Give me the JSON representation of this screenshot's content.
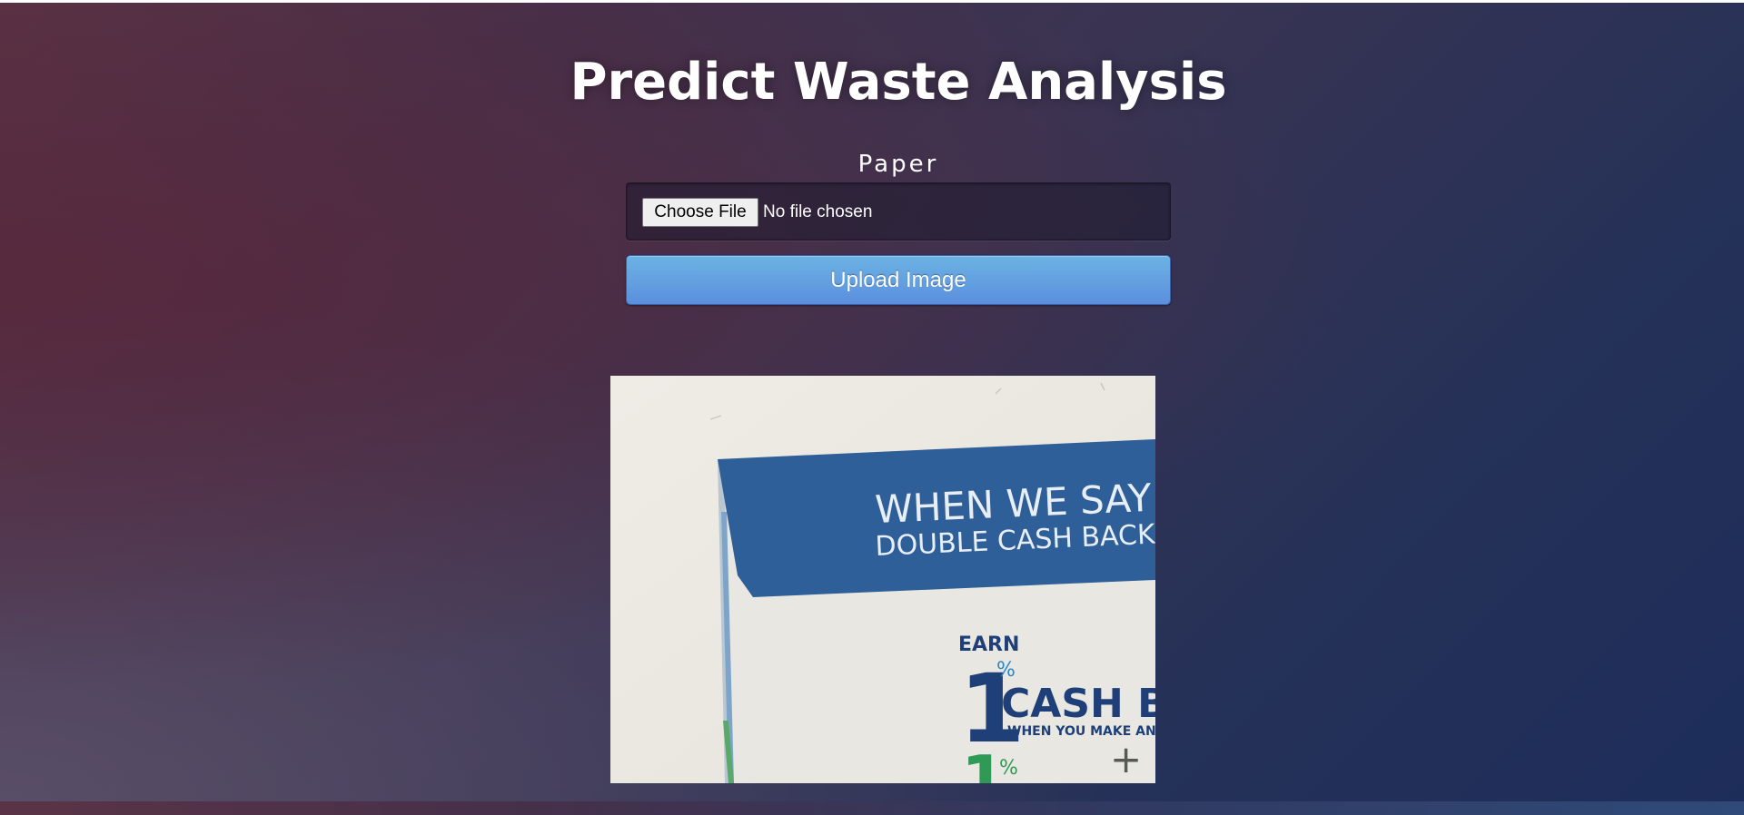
{
  "header": {
    "title": "Predict Waste Analysis"
  },
  "prediction": {
    "label": "Paper"
  },
  "upload_form": {
    "choose_file_label": "Choose File",
    "file_status": "No file chosen",
    "submit_label": "Upload Image"
  },
  "preview_image": {
    "headline_1": "WHEN WE SAY",
    "headline_2": "DOUBLE CASH BACK",
    "earn": "EARN",
    "big_digit": "1",
    "percent": "%",
    "cash": "CASH B",
    "when_text": "WHEN YOU MAKE AN",
    "plus": "+",
    "second_digit": "1",
    "second_percent": "%"
  },
  "colors": {
    "upload_button": "#5b8fdd",
    "card_blue": "#2f5f98",
    "digit_dark_blue": "#1f3f78",
    "digit_green": "#2f9a56"
  }
}
